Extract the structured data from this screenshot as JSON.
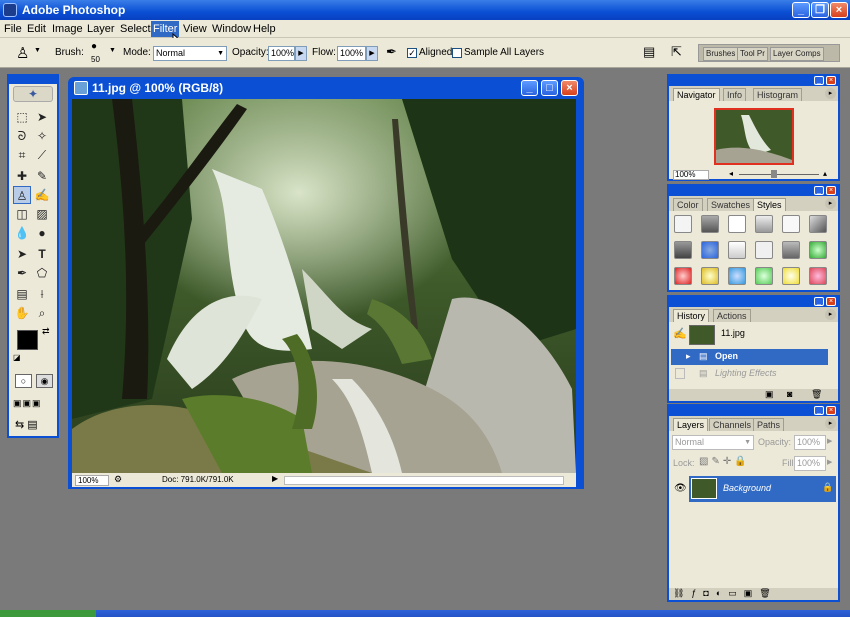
{
  "app": {
    "title": "Adobe Photoshop"
  },
  "menu": [
    "File",
    "Edit",
    "Image",
    "Layer",
    "Select",
    "Filter",
    "View",
    "Window",
    "Help"
  ],
  "menu_active": "Filter",
  "options": {
    "brush_label": "Brush:",
    "brush_size": "50",
    "mode_label": "Mode:",
    "mode_value": "Normal",
    "opacity_label": "Opacity:",
    "opacity_value": "100%",
    "flow_label": "Flow:",
    "flow_value": "100%",
    "aligned_label": "Aligned",
    "sample_all_label": "Sample All Layers",
    "well_tabs": [
      "Brushes",
      "Tool Pr",
      "Layer Comps"
    ]
  },
  "document": {
    "title": "11.jpg @ 100% (RGB/8)",
    "zoom": "100%",
    "doc_info": "Doc: 791.0K/791.0K"
  },
  "navigator": {
    "tabs": [
      "Navigator",
      "Info",
      "Histogram"
    ],
    "zoom": "100%"
  },
  "styles_panel": {
    "tabs": [
      "Color",
      "Swatches",
      "Styles"
    ]
  },
  "history": {
    "tabs": [
      "History",
      "Actions"
    ],
    "snapshot": "11.jpg",
    "items": [
      "Open",
      "Lighting Effects"
    ]
  },
  "layers": {
    "tabs": [
      "Layers",
      "Channels",
      "Paths"
    ],
    "blend": "Normal",
    "opacity_label": "Opacity:",
    "opacity_value": "100%",
    "lock_label": "Lock:",
    "fill_label": "Fill:",
    "fill_value": "100%",
    "layer_name": "Background"
  },
  "colors": {
    "title_blue": "#0a4fd4",
    "selection": "#316ac5",
    "chrome": "#ece9d8",
    "workspace": "#7a7a7a"
  }
}
